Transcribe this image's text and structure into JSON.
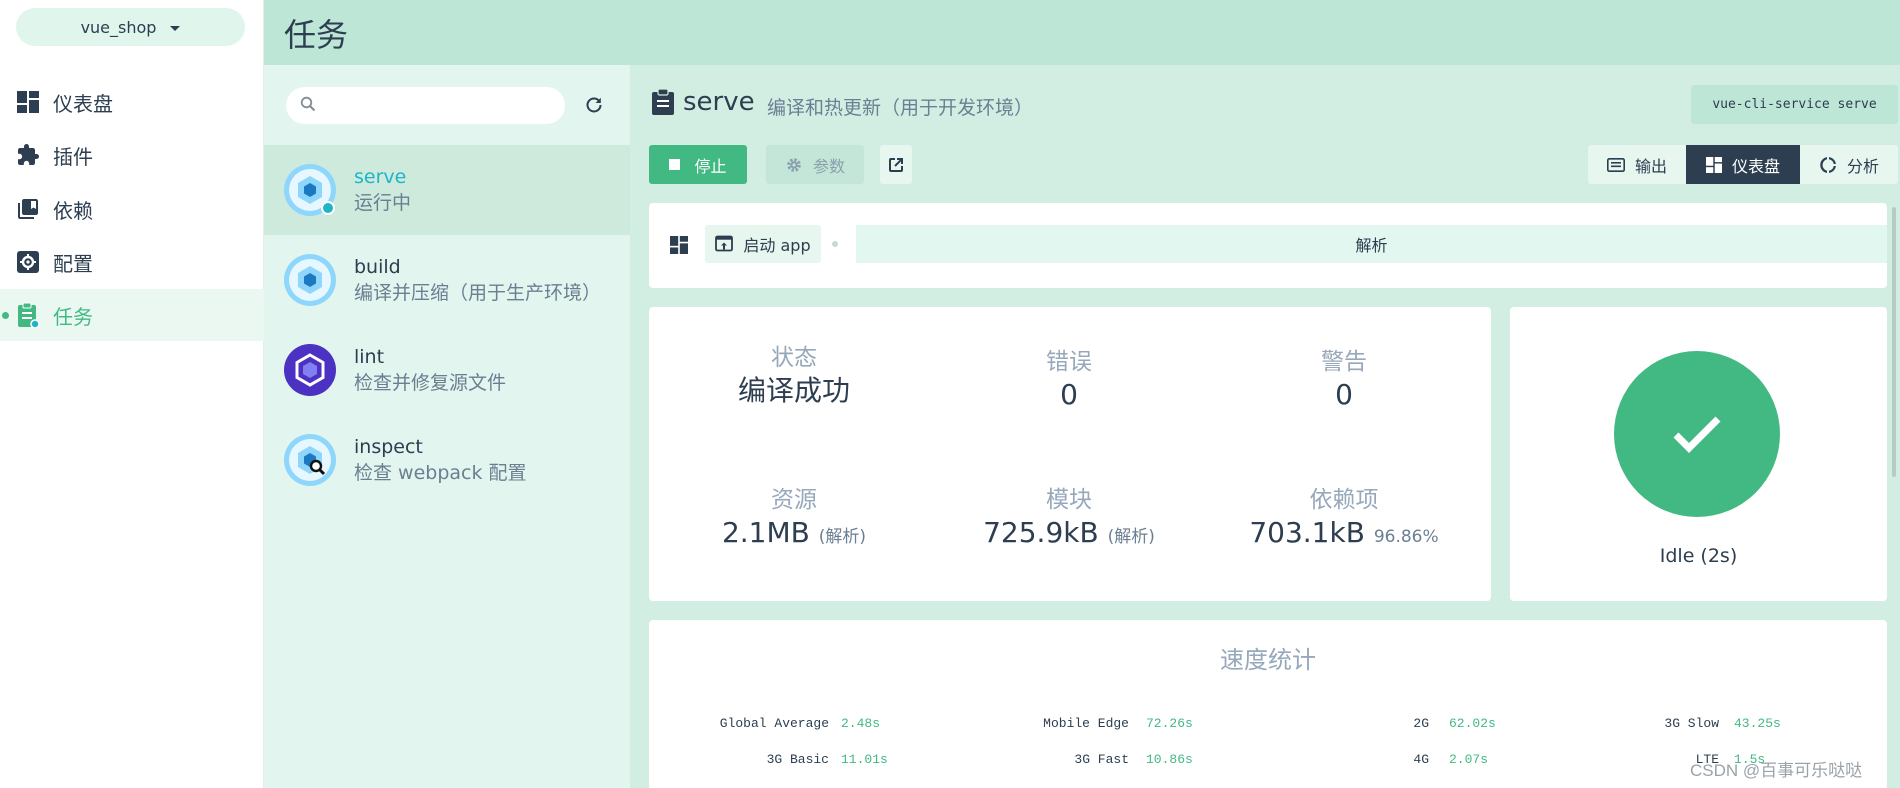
{
  "nav": {
    "project": "vue_shop",
    "items": [
      {
        "label": "仪表盘"
      },
      {
        "label": "插件"
      },
      {
        "label": "依赖"
      },
      {
        "label": "配置"
      },
      {
        "label": "任务"
      }
    ]
  },
  "topbar": {
    "title": "任务"
  },
  "tasklist": {
    "search_placeholder": "",
    "tasks": [
      {
        "name": "serve",
        "desc": "运行中"
      },
      {
        "name": "build",
        "desc": "编译并压缩（用于生产环境）"
      },
      {
        "name": "lint",
        "desc": "检查并修复源文件"
      },
      {
        "name": "inspect",
        "desc": "检查 webpack 配置"
      }
    ]
  },
  "main": {
    "task_name": "serve",
    "task_desc": "编译和热更新（用于开发环境）",
    "command": "vue-cli-service serve",
    "stop_label": "停止",
    "params_label": "参数",
    "tabs": [
      "输出",
      "仪表盘",
      "分析"
    ],
    "toolbar": {
      "start_label": "启动 app",
      "analyze_label": "解析"
    },
    "stats": {
      "status_label": "状态",
      "status_value": "编译成功",
      "errors_label": "错误",
      "errors_value": "0",
      "warnings_label": "警告",
      "warnings_value": "0",
      "assets_label": "资源",
      "assets_value": "2.1MB",
      "assets_note": "(解析)",
      "modules_label": "模块",
      "modules_value": "725.9kB",
      "modules_note": "(解析)",
      "deps_label": "依赖项",
      "deps_value": "703.1kB",
      "deps_note": "96.86%"
    },
    "status_card": {
      "text": "Idle (2s)"
    },
    "speed": {
      "title": "速度统计",
      "rows": [
        [
          {
            "label": "Global Average",
            "value": "2.48s"
          },
          {
            "label": "Mobile Edge",
            "value": "72.26s"
          },
          {
            "label": "2G",
            "value": "62.02s"
          },
          {
            "label": "3G Slow",
            "value": "43.25s"
          }
        ],
        [
          {
            "label": "3G Basic",
            "value": "11.01s"
          },
          {
            "label": "3G Fast",
            "value": "10.86s"
          },
          {
            "label": "4G",
            "value": "2.07s"
          },
          {
            "label": "LTE",
            "value": "1.5s"
          }
        ]
      ]
    }
  },
  "watermark": "CSDN @百事可乐哒哒",
  "colors": {
    "accent": "#42b983",
    "dark": "#2c3e50",
    "topbar": "#bde6d6",
    "panel": "#d2eee3"
  }
}
